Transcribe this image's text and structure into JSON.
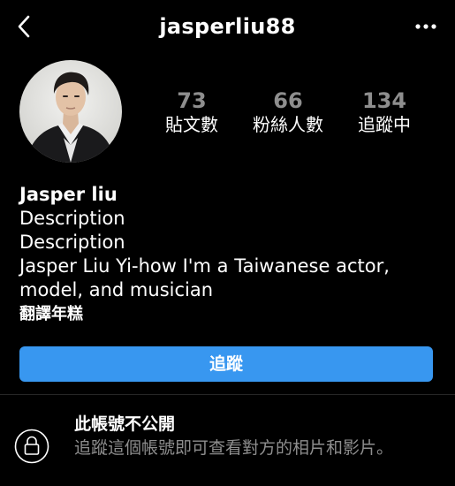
{
  "header": {
    "username": "jasperliu88",
    "back_icon": "chevron-left-icon",
    "more_icon": "more-horizontal-icon"
  },
  "profile": {
    "avatar_icon": "profile-avatar",
    "stats": [
      {
        "count": "73",
        "label": "貼文數"
      },
      {
        "count": "66",
        "label": "粉絲人數"
      },
      {
        "count": "134",
        "label": "追蹤中"
      }
    ],
    "name": "Jasper liu",
    "bio_lines": [
      "Description",
      "Description",
      "Jasper Liu Yi-how I'm a Taiwanese actor,",
      "model, and musician"
    ],
    "translate_label": "翻譯年糕"
  },
  "actions": {
    "follow_label": "追蹤"
  },
  "private": {
    "title": "此帳號不公開",
    "description": "追蹤這個帳號即可查看對方的相片和影片。",
    "icon": "lock-icon"
  },
  "colors": {
    "background": "#000000",
    "accent": "#3897f0",
    "muted_text": "#8e8e8e"
  }
}
